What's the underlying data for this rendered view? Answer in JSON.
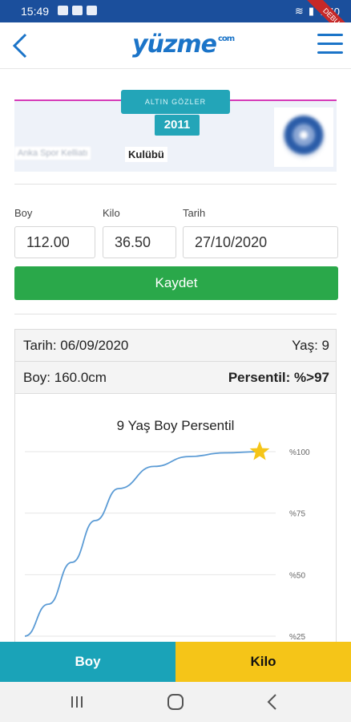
{
  "status": {
    "time": "15:49",
    "battery": "%40"
  },
  "debug_banner": "DEBUG",
  "header": {
    "logo": "yüzme",
    "logo_suffix": "com"
  },
  "club": {
    "name_badge": "ALTIN GÖZLER",
    "year": "2011",
    "owner": "Anka Spor Kelliatı",
    "type_label": "Kulübü"
  },
  "form": {
    "height_label": "Boy",
    "weight_label": "Kilo",
    "date_label": "Tarih",
    "height_value": "112.00",
    "weight_value": "36.50",
    "date_value": "27/10/2020",
    "save_label": "Kaydet"
  },
  "result": {
    "date_text": "Tarih: 06/09/2020",
    "age_text": "Yaş: 9",
    "height_text": "Boy: 160.0cm",
    "percentile_text": "Persentil: %>97"
  },
  "chart_data": {
    "type": "line",
    "title": "9 Yaş Boy Persentil",
    "y_ticks": [
      "%100",
      "%75",
      "%50",
      "%25"
    ],
    "ylim": [
      25,
      100
    ],
    "series": [
      {
        "values": [
          {
            "x": 0.0,
            "y": 25
          },
          {
            "x": 0.1,
            "y": 38
          },
          {
            "x": 0.2,
            "y": 55
          },
          {
            "x": 0.3,
            "y": 72
          },
          {
            "x": 0.4,
            "y": 85
          },
          {
            "x": 0.55,
            "y": 94
          },
          {
            "x": 0.7,
            "y": 98
          },
          {
            "x": 0.85,
            "y": 99.5
          },
          {
            "x": 1.0,
            "y": 100
          }
        ]
      }
    ],
    "marker": {
      "x": 1.0,
      "y": 100
    },
    "grid": true,
    "colors": {
      "line": "#5b9bd5",
      "marker": "#f5c518",
      "grid": "#e6e6e6"
    }
  },
  "tabs": {
    "height": "Boy",
    "weight": "Kilo"
  }
}
